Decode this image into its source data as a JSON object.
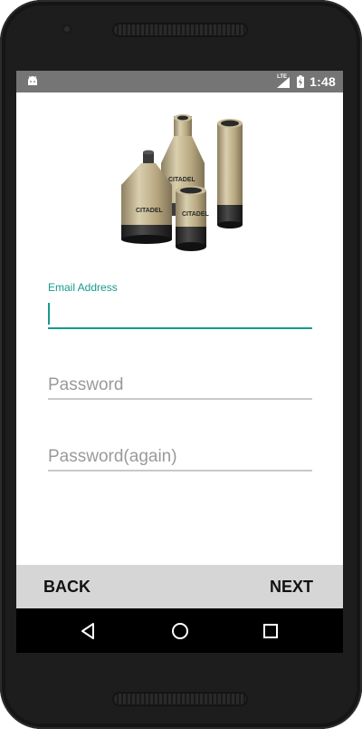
{
  "status_bar": {
    "network_label": "LTE",
    "time": "1:48"
  },
  "logo": {
    "brand": "CITADEL"
  },
  "form": {
    "email": {
      "label": "Email Address",
      "value": "",
      "placeholder": ""
    },
    "password": {
      "value": "",
      "placeholder": "Password"
    },
    "password_again": {
      "value": "",
      "placeholder": "Password(again)"
    }
  },
  "actions": {
    "back_label": "BACK",
    "next_label": "NEXT"
  },
  "navigation": {
    "back_icon": "triangle-back-icon",
    "home_icon": "circle-home-icon",
    "recents_icon": "square-recents-icon"
  },
  "colors": {
    "accent": "#169a8c",
    "status_bar": "#757575",
    "button_bar": "#d6d6d6",
    "nav_bar": "#000000",
    "product_gold": "#b7a77f"
  }
}
